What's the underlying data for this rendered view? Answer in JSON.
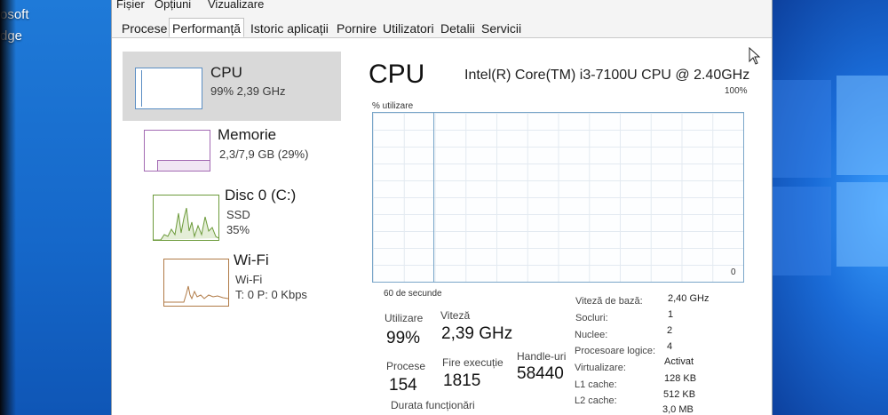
{
  "desktop": {
    "icon_label_1": "osoft",
    "icon_label_2": "dge"
  },
  "window": {
    "menu": [
      "Fișier",
      "Opțiuni",
      "Vizualizare"
    ],
    "tabs": [
      "Procese",
      "Performanță",
      "Istoric aplicații",
      "Pornire",
      "Utilizatori",
      "Detalii",
      "Servicii"
    ],
    "active_tab": "Performanță"
  },
  "sidebar": {
    "items": [
      {
        "title": "CPU",
        "sub1": "99% 2,39 GHz",
        "sub2": ""
      },
      {
        "title": "Memorie",
        "sub1": "2,3/7,9 GB (29%)",
        "sub2": ""
      },
      {
        "title": "Disc 0 (C:)",
        "sub1": "SSD",
        "sub2": "35%"
      },
      {
        "title": "Wi-Fi",
        "sub1": "Wi-Fi",
        "sub2": "T: 0 P: 0 Kbps"
      }
    ]
  },
  "panel": {
    "title": "CPU",
    "model": "Intel(R) Core(TM) i3-7100U CPU @ 2.40GHz",
    "graph_label": "% utilizare",
    "graph_max": "100%",
    "graph_min": "0",
    "graph_span": "60 de secunde",
    "stats": {
      "utilizare_label": "Utilizare",
      "utilizare_val": "99%",
      "viteza_label": "Viteză",
      "viteza_val": "2,39 GHz",
      "procese_label": "Procese",
      "procese_val": "154",
      "fire_label": "Fire execuție",
      "fire_val": "1815",
      "handle_label": "Handle-uri",
      "handle_val": "58440",
      "durata_label": "Durata funcționări"
    },
    "specs": [
      {
        "label": "Viteză de bază:",
        "value": "2,40 GHz"
      },
      {
        "label": "Socluri:",
        "value": "1"
      },
      {
        "label": "Nuclee:",
        "value": "2"
      },
      {
        "label": "Procesoare logice:",
        "value": "4"
      },
      {
        "label": "Virtualizare:",
        "value": "Activat"
      },
      {
        "label": "L1 cache:",
        "value": "128 KB"
      },
      {
        "label": "L2 cache:",
        "value": "512 KB"
      },
      {
        "label": "",
        "value": "3,0 MB"
      }
    ]
  }
}
